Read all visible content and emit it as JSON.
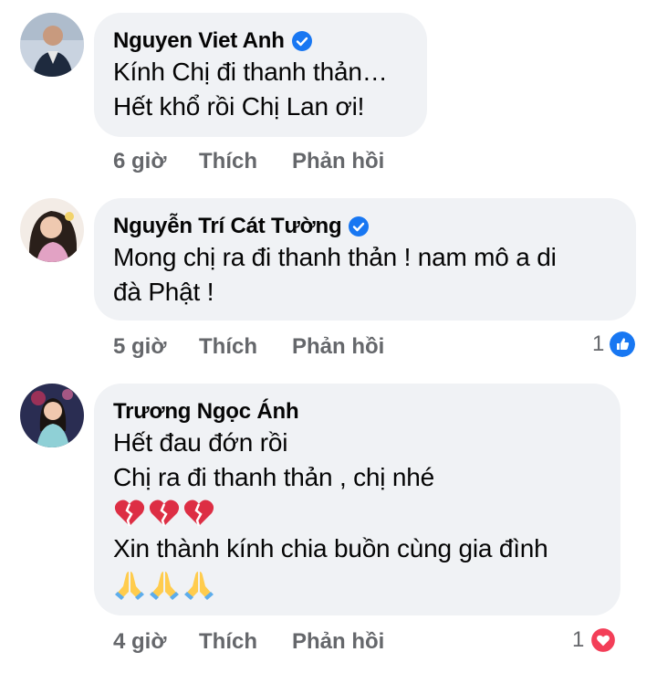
{
  "comments": [
    {
      "author": "Nguyen Viet Anh",
      "verified": true,
      "lines": [
        "Kính Chị đi thanh thản…",
        "Hết khổ rồi Chị Lan ơi!"
      ],
      "time": "6 giờ",
      "like_label": "Thích",
      "reply_label": "Phản hồi"
    },
    {
      "author": "Nguyễn Trí Cát Tường",
      "verified": true,
      "lines": [
        "Mong chị ra đi thanh thản ! nam mô a di",
        "đà Phật !"
      ],
      "time": "5 giờ",
      "like_label": "Thích",
      "reply_label": "Phản hồi",
      "reaction": {
        "count": "1",
        "icon": "like-icon",
        "color": "#1877f2"
      }
    },
    {
      "author": "Trương Ngọc Ánh",
      "verified": false,
      "lines": [
        "Hết đau đớn rồi",
        "Chị ra đi thanh thản , chị nhé",
        "Xin thành kính chia buồn cùng gia đình"
      ],
      "emoji_lines": [
        [
          "broken-heart-icon",
          "broken-heart-icon",
          "broken-heart-icon"
        ],
        [
          "folded-hands-icon",
          "folded-hands-icon",
          "folded-hands-icon"
        ]
      ],
      "time": "4 giờ",
      "like_label": "Thích",
      "reply_label": "Phản hồi",
      "reaction": {
        "count": "1",
        "icon": "love-icon",
        "color": "#f33e58"
      }
    }
  ],
  "colors": {
    "bubble": "#f0f2f5",
    "text": "#050505",
    "secondary": "#65676b",
    "verified": "#1877f2"
  }
}
